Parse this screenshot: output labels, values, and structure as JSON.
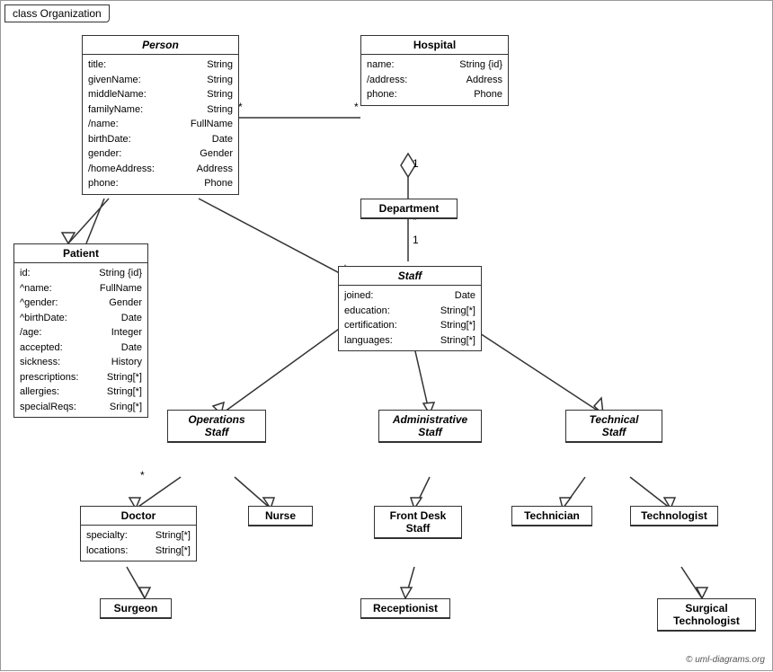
{
  "title": "class Organization",
  "copyright": "© uml-diagrams.org",
  "classes": {
    "person": {
      "name": "Person",
      "italic": true,
      "attrs": [
        {
          "name": "title:",
          "type": "String"
        },
        {
          "name": "givenName:",
          "type": "String"
        },
        {
          "name": "middleName:",
          "type": "String"
        },
        {
          "name": "familyName:",
          "type": "String"
        },
        {
          "name": "/name:",
          "type": "FullName"
        },
        {
          "name": "birthDate:",
          "type": "Date"
        },
        {
          "name": "gender:",
          "type": "Gender"
        },
        {
          "name": "/homeAddress:",
          "type": "Address"
        },
        {
          "name": "phone:",
          "type": "Phone"
        }
      ]
    },
    "hospital": {
      "name": "Hospital",
      "italic": false,
      "attrs": [
        {
          "name": "name:",
          "type": "String {id}"
        },
        {
          "name": "/address:",
          "type": "Address"
        },
        {
          "name": "phone:",
          "type": "Phone"
        }
      ]
    },
    "department": {
      "name": "Department",
      "italic": false,
      "attrs": []
    },
    "staff": {
      "name": "Staff",
      "italic": true,
      "attrs": [
        {
          "name": "joined:",
          "type": "Date"
        },
        {
          "name": "education:",
          "type": "String[*]"
        },
        {
          "name": "certification:",
          "type": "String[*]"
        },
        {
          "name": "languages:",
          "type": "String[*]"
        }
      ]
    },
    "patient": {
      "name": "Patient",
      "italic": false,
      "attrs": [
        {
          "name": "id:",
          "type": "String {id}"
        },
        {
          "name": "^name:",
          "type": "FullName"
        },
        {
          "name": "^gender:",
          "type": "Gender"
        },
        {
          "name": "^birthDate:",
          "type": "Date"
        },
        {
          "name": "/age:",
          "type": "Integer"
        },
        {
          "name": "accepted:",
          "type": "Date"
        },
        {
          "name": "sickness:",
          "type": "History"
        },
        {
          "name": "prescriptions:",
          "type": "String[*]"
        },
        {
          "name": "allergies:",
          "type": "String[*]"
        },
        {
          "name": "specialReqs:",
          "type": "Sring[*]"
        }
      ]
    },
    "operations_staff": {
      "name": "Operations Staff",
      "italic": true,
      "attrs": []
    },
    "administrative_staff": {
      "name": "Administrative Staff",
      "italic": true,
      "attrs": []
    },
    "technical_staff": {
      "name": "Technical Staff",
      "italic": true,
      "attrs": []
    },
    "doctor": {
      "name": "Doctor",
      "italic": false,
      "attrs": [
        {
          "name": "specialty:",
          "type": "String[*]"
        },
        {
          "name": "locations:",
          "type": "String[*]"
        }
      ]
    },
    "nurse": {
      "name": "Nurse",
      "italic": false,
      "attrs": []
    },
    "front_desk_staff": {
      "name": "Front Desk Staff",
      "italic": false,
      "attrs": []
    },
    "technician": {
      "name": "Technician",
      "italic": false,
      "attrs": []
    },
    "technologist": {
      "name": "Technologist",
      "italic": false,
      "attrs": []
    },
    "surgeon": {
      "name": "Surgeon",
      "italic": false,
      "attrs": []
    },
    "receptionist": {
      "name": "Receptionist",
      "italic": false,
      "attrs": []
    },
    "surgical_technologist": {
      "name": "Surgical Technologist",
      "italic": false,
      "attrs": []
    }
  }
}
